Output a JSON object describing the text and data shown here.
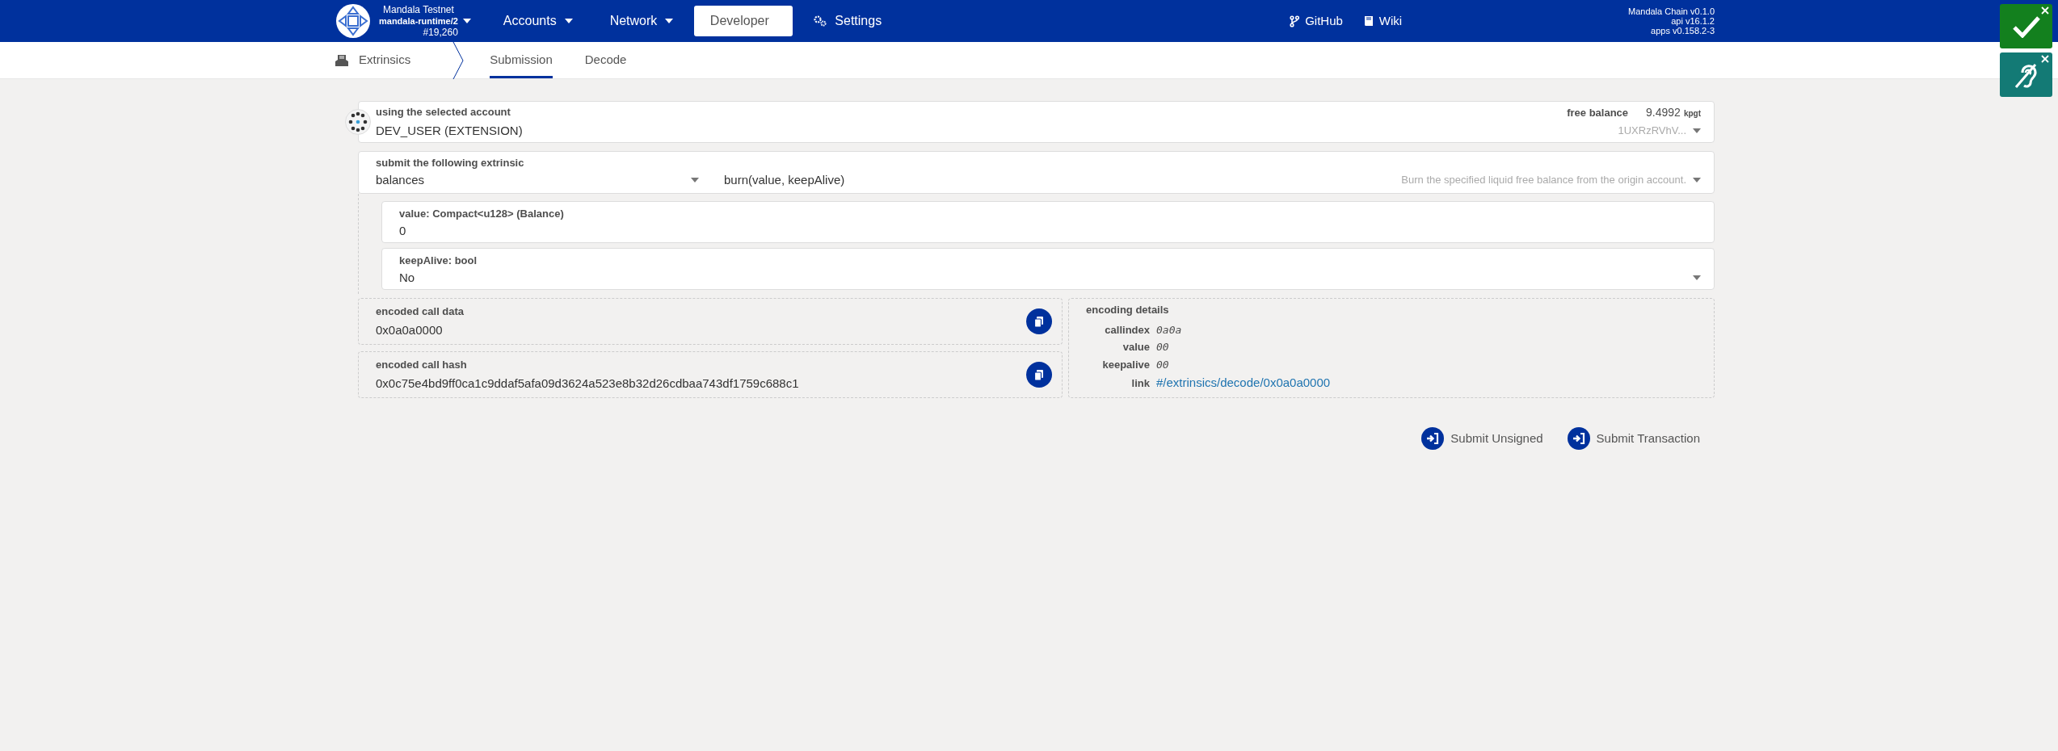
{
  "chain": {
    "name": "Mandala Testnet",
    "runtime": "mandala-runtime/2",
    "block": "#19,260"
  },
  "nav": [
    {
      "label": "Accounts",
      "selected": false,
      "kind": "menu"
    },
    {
      "label": "Network",
      "selected": false,
      "kind": "menu"
    },
    {
      "label": "Developer",
      "selected": true,
      "kind": "menu"
    },
    {
      "label": "Settings",
      "selected": false,
      "kind": "settings"
    }
  ],
  "links": [
    {
      "label": "GitHub",
      "kind": "github"
    },
    {
      "label": "Wiki",
      "kind": "wiki"
    }
  ],
  "versions": [
    "Mandala Chain v0.1.0",
    "api v16.1.2",
    "apps v0.158.2-3"
  ],
  "notifications": [
    {
      "kind": "success"
    },
    {
      "kind": "hearing"
    }
  ],
  "section": {
    "title": "Extrinsics"
  },
  "tabs": [
    {
      "label": "Submission",
      "selected": true
    },
    {
      "label": "Decode",
      "selected": false
    }
  ],
  "account": {
    "label": "using the selected account",
    "value": "DEV_USER (EXTENSION)",
    "balance_label": "free balance",
    "balance": "9.4992",
    "unit": "kpgt",
    "address": "1UXRzRVhV..."
  },
  "extrinsic": {
    "label": "submit the following extrinsic",
    "section": "balances",
    "method": "burn(value, keepAlive)",
    "doc": "Burn the specified liquid free balance from the origin account."
  },
  "params": [
    {
      "label": "value: Compact<u128> (Balance)",
      "value": "0",
      "kind": "input"
    },
    {
      "label": "keepAlive: bool",
      "value": "No",
      "kind": "dropdown"
    }
  ],
  "encoded": [
    {
      "label": "encoded call data",
      "value": "0x0a0a0000"
    },
    {
      "label": "encoded call hash",
      "value": "0x0c75e4bd9ff0ca1c9ddaf5afa09d3624a523e8b32d26cdbaa743df1759c688c1"
    }
  ],
  "details": {
    "title": "encoding details",
    "rows": [
      {
        "key": "callindex",
        "value": "0a0a",
        "kind": "code"
      },
      {
        "key": "value",
        "value": "00",
        "kind": "code"
      },
      {
        "key": "keepalive",
        "value": "00",
        "kind": "code"
      },
      {
        "key": "link",
        "value": "#/extrinsics/decode/0x0a0a0000",
        "kind": "link"
      }
    ]
  },
  "actions": [
    "Submit Unsigned",
    "Submit Transaction"
  ]
}
